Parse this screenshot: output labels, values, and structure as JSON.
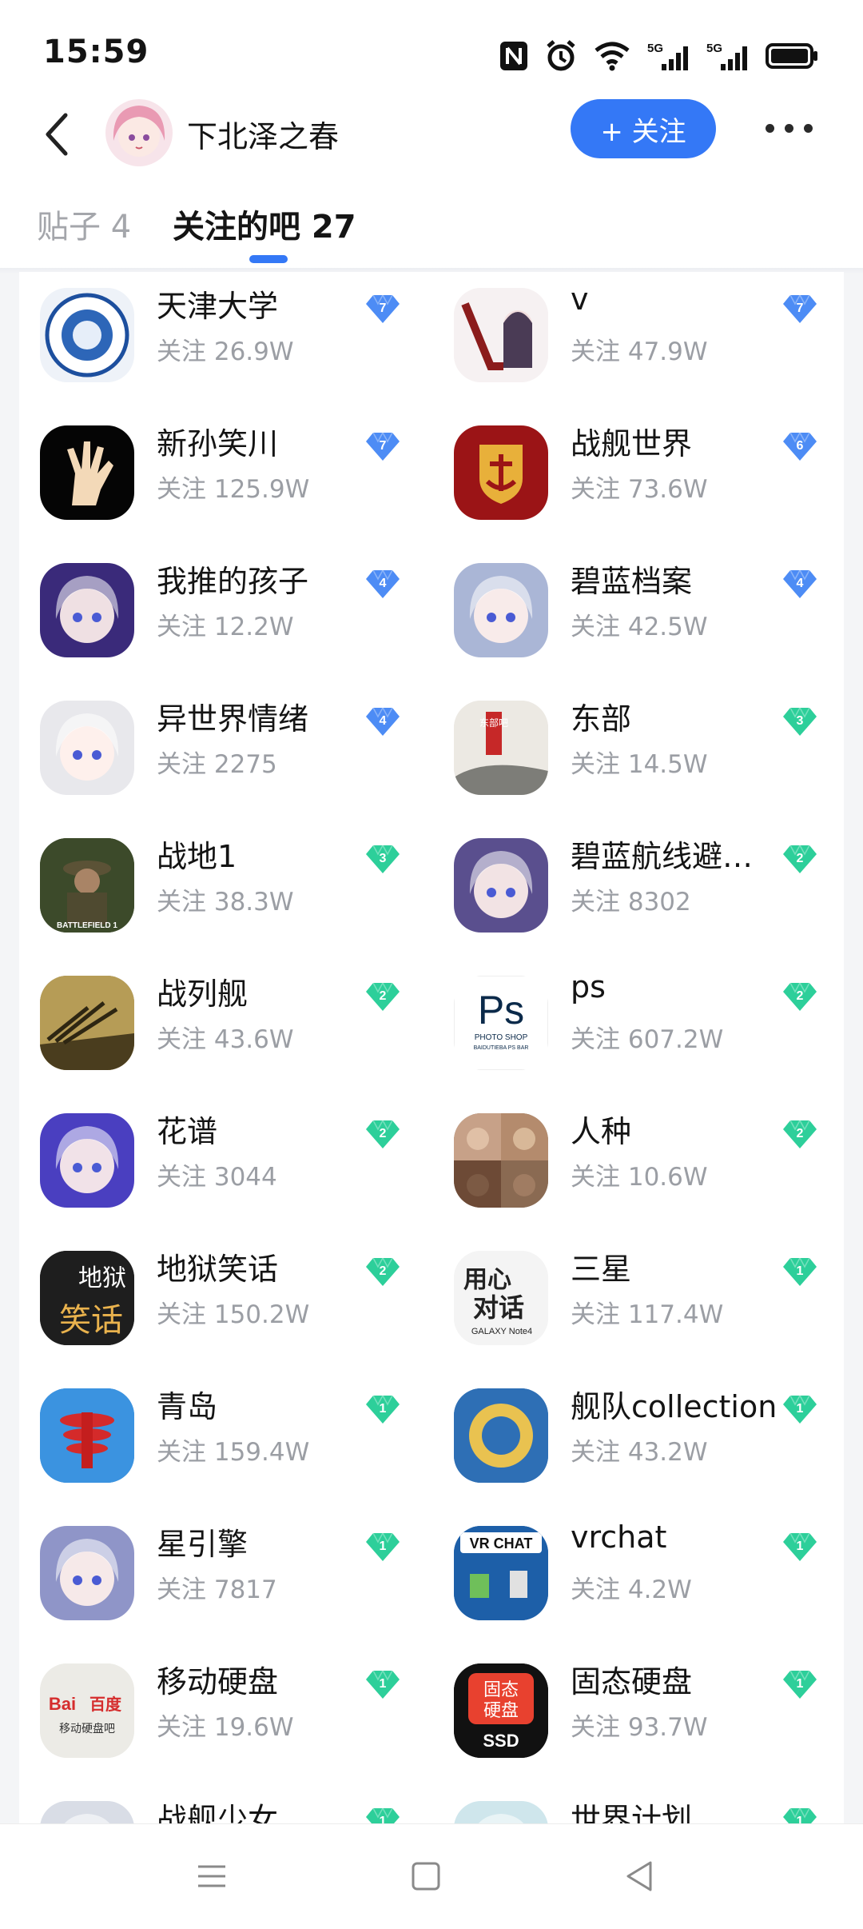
{
  "status_bar": {
    "time": "15:59"
  },
  "header": {
    "username": "下北泽之春",
    "follow_label": "+ 关注"
  },
  "tabs": [
    {
      "label": "贴子 4"
    },
    {
      "label": "关注的吧 27"
    }
  ],
  "meta_prefix": "关注",
  "bars": [
    {
      "name": "天津大学",
      "followers": "关注 26.9W",
      "level": "7",
      "badge": "blue",
      "icon_bg": "#eef2f8",
      "icon": "university-seal-icon"
    },
    {
      "name": "v",
      "followers": "关注 47.9W",
      "level": "7",
      "badge": "blue",
      "icon_bg": "#f6f1f2",
      "icon": "anime-v-icon"
    },
    {
      "name": "新孙笑川",
      "followers": "关注 125.9W",
      "level": "7",
      "badge": "blue",
      "icon_bg": "#050505",
      "icon": "hand-icon"
    },
    {
      "name": "战舰世界",
      "followers": "关注 73.6W",
      "level": "6",
      "badge": "blue",
      "icon_bg": "#9b1416",
      "icon": "anchor-shield-icon"
    },
    {
      "name": "我推的孩子",
      "followers": "关注 12.2W",
      "level": "4",
      "badge": "blue",
      "icon_bg": "#3a2a7a",
      "icon": "anime-girl-icon"
    },
    {
      "name": "碧蓝档案",
      "followers": "关注 42.5W",
      "level": "4",
      "badge": "blue",
      "icon_bg": "#aab6d6",
      "icon": "anime-girl-icon"
    },
    {
      "name": "异世界情绪",
      "followers": "关注 2275",
      "level": "4",
      "badge": "blue",
      "icon_bg": "#e8e8ec",
      "icon": "anime-girl-icon"
    },
    {
      "name": "东部",
      "followers": "关注 14.5W",
      "level": "3",
      "badge": "green",
      "icon_bg": "#e9e6e1",
      "icon": "ink-painting-icon"
    },
    {
      "name": "战地1",
      "followers": "关注 38.3W",
      "level": "3",
      "badge": "green",
      "icon_bg": "#3c4a2a",
      "icon": "soldier-icon"
    },
    {
      "name": "碧蓝航线避…",
      "followers": "关注 8302",
      "level": "2",
      "badge": "green",
      "icon_bg": "#5a4f8e",
      "icon": "anime-girl-icon"
    },
    {
      "name": "战列舰",
      "followers": "关注 43.6W",
      "level": "2",
      "badge": "green",
      "icon_bg": "#8e7a3e",
      "icon": "battleship-icon"
    },
    {
      "name": "ps",
      "followers": "关注 607.2W",
      "level": "2",
      "badge": "green",
      "icon_bg": "#ffffff",
      "icon": "photoshop-icon"
    },
    {
      "name": "花谱",
      "followers": "关注 3044",
      "level": "2",
      "badge": "green",
      "icon_bg": "#4a3fc0",
      "icon": "anime-girl-icon"
    },
    {
      "name": "人种",
      "followers": "关注 10.6W",
      "level": "2",
      "badge": "green",
      "icon_bg": "#8a6f5c",
      "icon": "faces-grid-icon"
    },
    {
      "name": "地狱笑话",
      "followers": "关注 150.2W",
      "level": "2",
      "badge": "green",
      "icon_bg": "#1e1e1e",
      "icon": "hell-joke-icon"
    },
    {
      "name": "三星",
      "followers": "关注 117.4W",
      "level": "1",
      "badge": "green",
      "icon_bg": "#f4f4f4",
      "icon": "galaxy-note-icon"
    },
    {
      "name": "青岛",
      "followers": "关注 159.4W",
      "level": "1",
      "badge": "green",
      "icon_bg": "#2a84d6",
      "icon": "tower-icon"
    },
    {
      "name": "舰队collection",
      "followers": "关注 43.2W",
      "level": "1",
      "badge": "green",
      "icon_bg": "#2e6fb5",
      "icon": "kancolle-icon"
    },
    {
      "name": "星引擎",
      "followers": "关注 7817",
      "level": "1",
      "badge": "green",
      "icon_bg": "#8f95c8",
      "icon": "anime-girl-icon"
    },
    {
      "name": "vrchat",
      "followers": "关注 4.2W",
      "level": "1",
      "badge": "green",
      "icon_bg": "#1d5fa8",
      "icon": "vrchat-icon"
    },
    {
      "name": "移动硬盘",
      "followers": "关注 19.6W",
      "level": "1",
      "badge": "green",
      "icon_bg": "#ecebe6",
      "icon": "baidu-icon"
    },
    {
      "name": "固态硬盘",
      "followers": "关注 93.7W",
      "level": "1",
      "badge": "green",
      "icon_bg": "#111111",
      "icon": "ssd-icon"
    },
    {
      "name": "战舰少女",
      "followers": "",
      "level": "1",
      "badge": "green",
      "icon_bg": "#d9dde6",
      "icon": "anime-girl-icon"
    },
    {
      "name": "世界计划",
      "followers": "",
      "level": "1",
      "badge": "green",
      "icon_bg": "#cfe6ec",
      "icon": "anime-girl-icon"
    }
  ],
  "icon_text": {
    "tv_bar_top": "地狱",
    "tv_bar_bottom": "笑话",
    "ps_main": "Ps",
    "ps_sub": "PHOTO SHOP",
    "ps_sub2": "BAIDUTIEBA PS BAR",
    "samsung_1": "用心",
    "samsung_2": "对话",
    "samsung_3": "GALAXY Note4",
    "vrchat": "VR CHAT",
    "baidu_1": "Bai",
    "baidu_2": "百度",
    "baidu_3": "移动硬盘吧",
    "ssd_1": "固态",
    "ssd_2": "硬盘",
    "ssd_3": "SSD",
    "bf": "BATTLEFIELD 1",
    "east": "东部吧"
  },
  "colors": {
    "accent": "#3478f6",
    "badge_blue": "#4d8cf5",
    "badge_green": "#2dcf9a"
  }
}
